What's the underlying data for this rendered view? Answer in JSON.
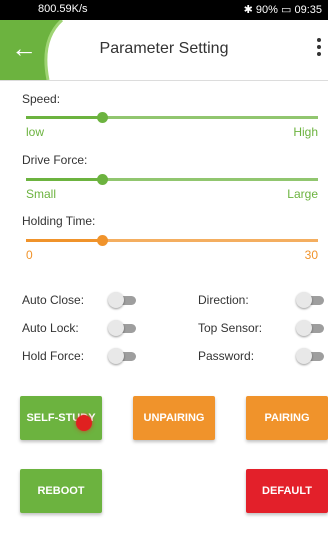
{
  "status_bar": {
    "network": "800.59K/s",
    "battery": "90%",
    "time": "09:35"
  },
  "header": {
    "title": "Parameter Setting",
    "back_icon": "back-arrow-icon",
    "menu_icon": "more-vert-icon"
  },
  "colors": {
    "green": "#6cb33f",
    "orange": "#f0932b",
    "red": "#e3202a",
    "track_grey": "#e0e0e0"
  },
  "sliders": {
    "speed": {
      "label": "Speed:",
      "min_label": "low",
      "max_label": "High",
      "fraction": 0.26
    },
    "drive_force": {
      "label": "Drive Force:",
      "min_label": "Small",
      "max_label": "Large",
      "fraction": 0.26
    },
    "holding_time": {
      "label": "Holding Time:",
      "min_label": "0",
      "max_label": "30",
      "fraction": 0.26
    }
  },
  "toggles": {
    "auto_close": {
      "label": "Auto Close:",
      "on": false
    },
    "direction": {
      "label": "Direction:",
      "on": false
    },
    "auto_lock": {
      "label": "Auto Lock:",
      "on": false
    },
    "top_sensor": {
      "label": "Top Sensor:",
      "on": false
    },
    "hold_force": {
      "label": "Hold Force:",
      "on": false
    },
    "password": {
      "label": "Password:",
      "on": false
    }
  },
  "buttons": {
    "self_study": "SELF-STUDY",
    "unpairing": "UNPAIRING",
    "pairing": "PAIRING",
    "reboot": "REBOOT",
    "default": "DEFAULT"
  }
}
